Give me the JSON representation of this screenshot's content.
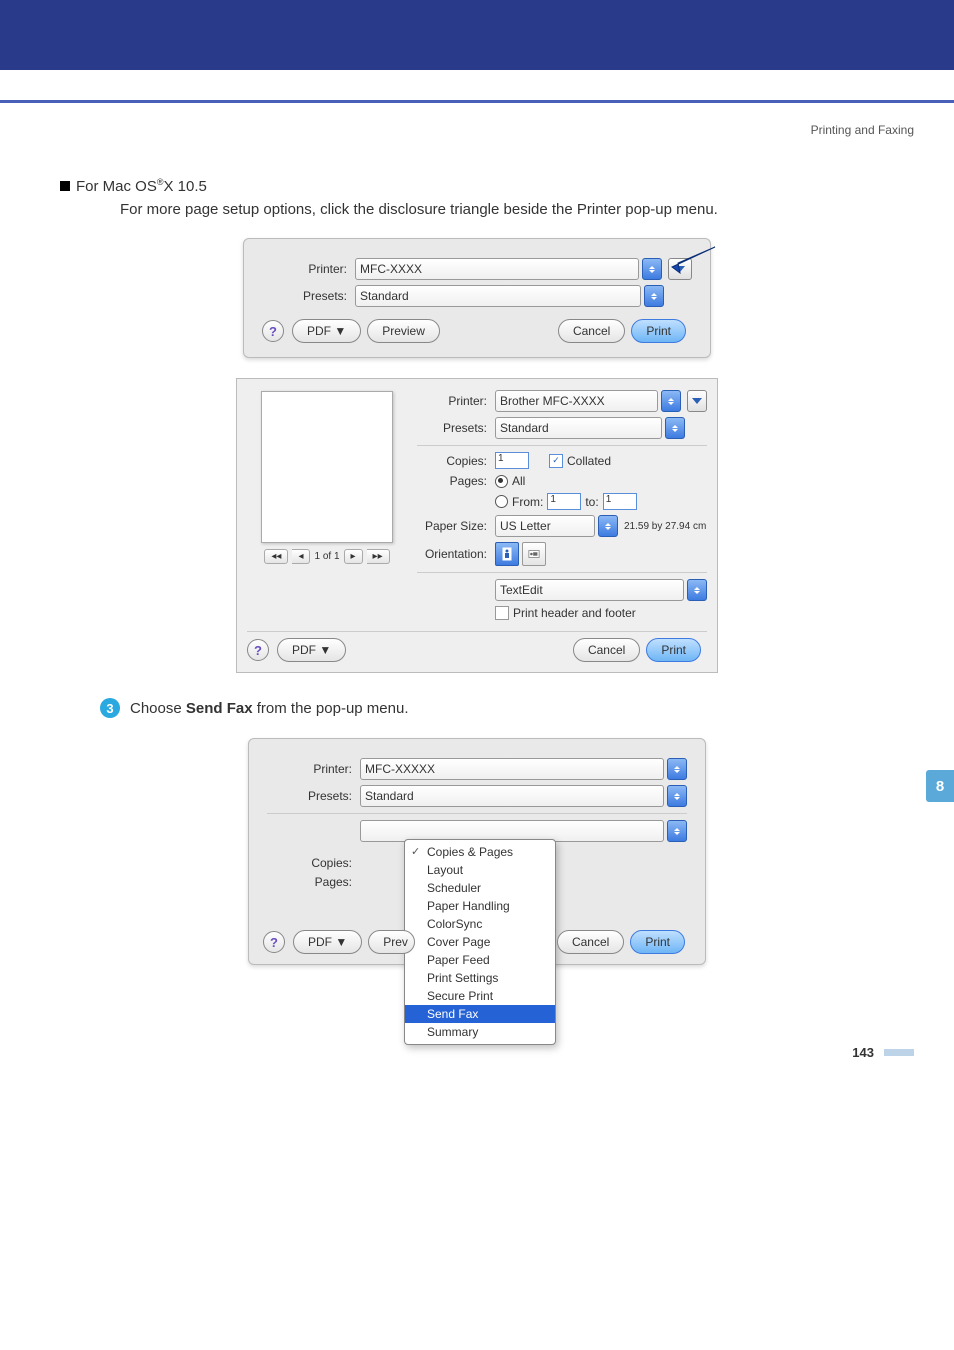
{
  "header_right": "Printing and Faxing",
  "section": {
    "title_prefix": "For Mac OS",
    "title_reg": "®",
    "title_suffix": "X 10.5",
    "subtext": "For more page setup options, click the disclosure triangle beside the Printer pop-up menu."
  },
  "dialog1": {
    "printer_label": "Printer:",
    "printer_value": "MFC-XXXX",
    "presets_label": "Presets:",
    "presets_value": "Standard",
    "pdf_btn": "PDF ▼",
    "preview_btn": "Preview",
    "cancel_btn": "Cancel",
    "print_btn": "Print"
  },
  "dialog2": {
    "printer_label": "Printer:",
    "printer_value": "Brother MFC-XXXX",
    "presets_label": "Presets:",
    "presets_value": "Standard",
    "copies_label": "Copies:",
    "copies_value": "1",
    "collated_label": "Collated",
    "pages_label": "Pages:",
    "pages_all": "All",
    "pages_from": "From:",
    "pages_from_v": "1",
    "pages_to": "to:",
    "pages_to_v": "1",
    "size_label": "Paper Size:",
    "size_value": "US Letter",
    "size_dim": "21.59 by 27.94 cm",
    "orient_label": "Orientation:",
    "sect_value": "TextEdit",
    "header_footer": "Print header and footer",
    "pager": "1 of 1",
    "pdf_btn": "PDF ▼",
    "cancel_btn": "Cancel",
    "print_btn": "Print"
  },
  "step3": {
    "num": "3",
    "text_a": "Choose ",
    "text_b": "Send Fax",
    "text_c": " from the pop-up menu."
  },
  "dialog3": {
    "printer_label": "Printer:",
    "printer_value": "MFC-XXXXX",
    "presets_label": "Presets:",
    "presets_value": "Standard",
    "copies_label": "Copies:",
    "pages_label": "Pages:",
    "pdf_btn": "PDF ▼",
    "prev_btn": "Prev",
    "cancel_btn": "Cancel",
    "print_btn": "Print",
    "menu": [
      "Copies & Pages",
      "Layout",
      "Scheduler",
      "Paper Handling",
      "ColorSync",
      "Cover Page",
      "Paper Feed",
      "Print Settings",
      "Secure Print",
      "Send Fax",
      "Summary"
    ]
  },
  "side_tab": "8",
  "page_number": "143"
}
